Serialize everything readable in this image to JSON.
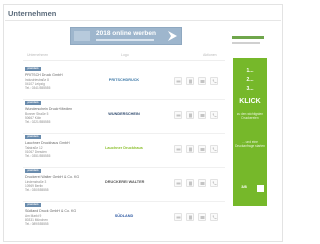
{
  "page": {
    "title": "Unternehmen"
  },
  "banner": {
    "text": "2018 online werben"
  },
  "table": {
    "headers": {
      "company": "Unternehmen",
      "logo": "Logo",
      "actions": "Aktionen"
    }
  },
  "rows": [
    {
      "badge": "premium",
      "name": "PRITSCH Druck GmbH",
      "street": "Industriestraße 8",
      "city": "04107 Leipzig",
      "phone": "Tel.: 0341/555555",
      "logo": "PRITSCHDRUCK",
      "logo_color": "#3f7aa8"
    },
    {
      "badge": "premium",
      "name": "Wunderschein Druck+Medien",
      "street": "Bonner Straße 5",
      "city": "50667 Köln",
      "phone": "Tel.: 0221/555555",
      "logo": "WUNDERSCHEIN",
      "logo_color": "#2f4a6e"
    },
    {
      "badge": "premium",
      "name": "Lauchner Druckhaus GmbH",
      "street": "Talstraße 12",
      "city": "01067 Dresden",
      "phone": "Tel.: 0351/555555",
      "logo": "Lauchner Druckhaus",
      "logo_color": "#8bbf2d"
    },
    {
      "badge": "premium",
      "name": "Druckerei Walter GmbH & Co. KG",
      "street": "Lindenstraße 3",
      "city": "10969 Berlin",
      "phone": "Tel.: 030/555555",
      "logo": "DRUCKEREI WALTER",
      "logo_color": "#555555"
    },
    {
      "badge": "premium",
      "name": "Südland Druck GmbH & Co. KG",
      "street": "Am Markt 9",
      "city": "80331 München",
      "phone": "Tel.: 089/555555",
      "logo": "SÜDLAND",
      "logo_color": "#2e5aa3"
    }
  ],
  "side_ad": {
    "line1": "1...",
    "line2": "2...",
    "line3": "3...",
    "headline": "KLICK",
    "body1": "zu den wichtigsten Druckereien",
    "body2": "... und eine Druckanfrage starten",
    "bottom": "3/8",
    "color": "#76b82a"
  },
  "icons": [
    "print-icon",
    "document-icon",
    "mail-icon",
    "phone-icon",
    "arrow-icon"
  ]
}
